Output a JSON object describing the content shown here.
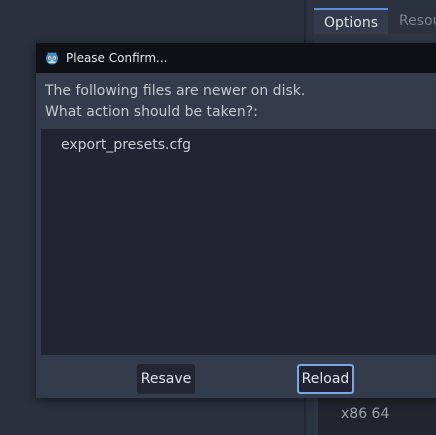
{
  "background": {
    "tabs": [
      {
        "label": "Options"
      },
      {
        "label": "Resou"
      }
    ],
    "list_item": "x86 64"
  },
  "dialog": {
    "title": "Please Confirm...",
    "message_line1": "The following files are newer on disk.",
    "message_line2": "What action should be taken?:",
    "files": [
      "export_presets.cfg"
    ],
    "buttons": {
      "resave": "Resave",
      "reload": "Reload"
    }
  },
  "colors": {
    "accent": "#7aa7e6",
    "titlebar": "#0f1117",
    "panel": "#343c4b"
  }
}
